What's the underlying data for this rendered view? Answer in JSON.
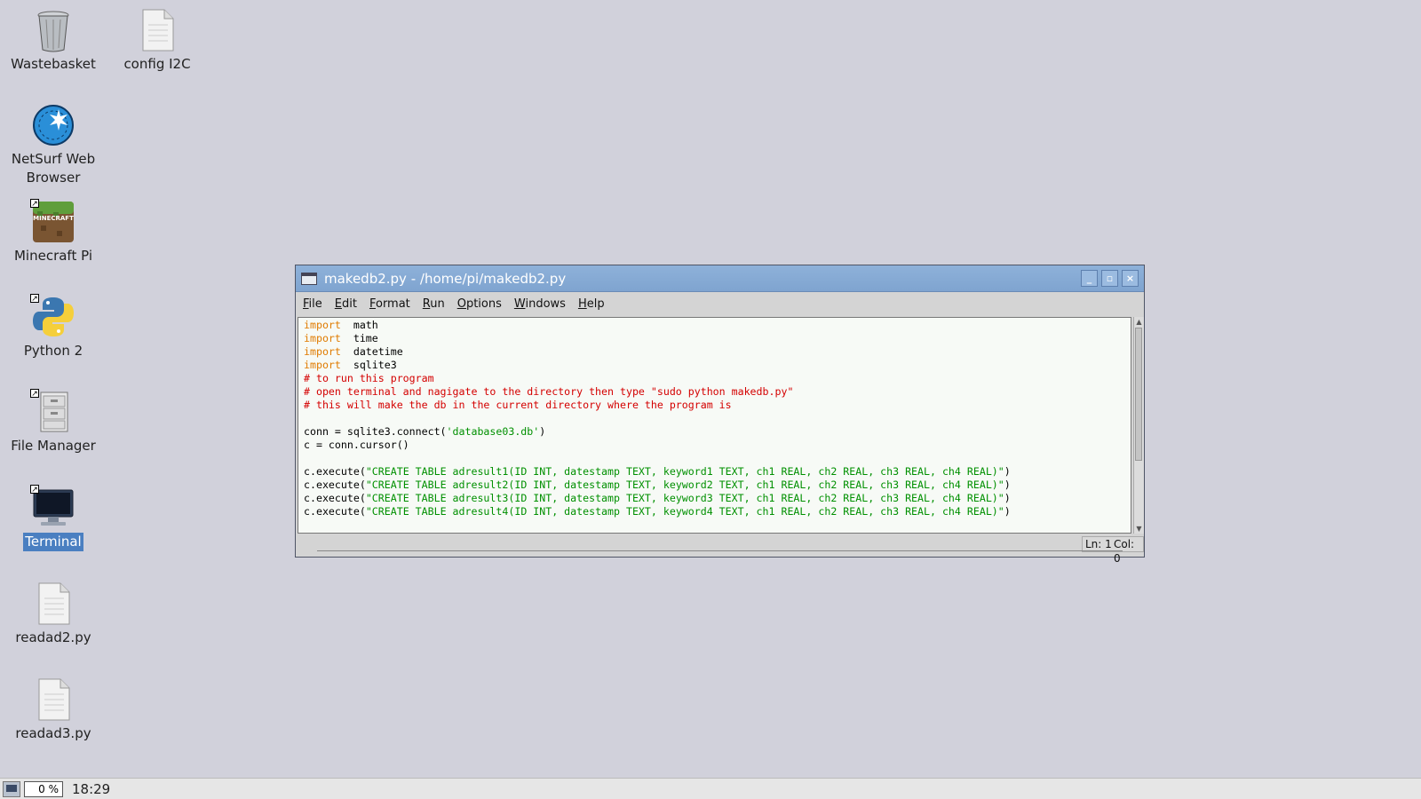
{
  "desktop": {
    "icons": [
      {
        "label": "Wastebasket",
        "icon": "trash-icon"
      },
      {
        "label": "config I2C",
        "icon": "file-icon"
      },
      {
        "label": "NetSurf Web Browser",
        "icon": "globe-icon"
      },
      {
        "label": "Minecraft Pi",
        "icon": "minecraft-icon"
      },
      {
        "label": "Python 2",
        "icon": "python-icon"
      },
      {
        "label": "File Manager",
        "icon": "cabinet-icon"
      },
      {
        "label": "Terminal",
        "icon": "monitor-icon"
      },
      {
        "label": "readad2.py",
        "icon": "file-icon"
      },
      {
        "label": "readad3.py",
        "icon": "file-icon"
      }
    ]
  },
  "window": {
    "title": "makedb2.py - /home/pi/makedb2.py",
    "menu": [
      {
        "label": "File",
        "underline": "F",
        "rest": "ile"
      },
      {
        "label": "Edit",
        "underline": "E",
        "rest": "dit"
      },
      {
        "label": "Format",
        "underline": "F",
        "rest": "ormat"
      },
      {
        "label": "Run",
        "underline": "R",
        "rest": "un"
      },
      {
        "label": "Options",
        "underline": "O",
        "rest": "ptions"
      },
      {
        "label": "Windows",
        "underline": "W",
        "rest": "indows"
      },
      {
        "label": "Help",
        "underline": "H",
        "rest": "elp"
      }
    ],
    "code_lines": [
      [
        [
          "kw",
          "import"
        ],
        [
          "",
          "  math"
        ]
      ],
      [
        [
          "kw",
          "import"
        ],
        [
          "",
          "  time"
        ]
      ],
      [
        [
          "kw",
          "import"
        ],
        [
          "",
          "  datetime"
        ]
      ],
      [
        [
          "kw",
          "import"
        ],
        [
          "",
          "  sqlite3"
        ]
      ],
      [
        [
          "cm",
          "# to run this program"
        ]
      ],
      [
        [
          "cm",
          "# open terminal and nagigate to the directory then type \"sudo python makedb.py\""
        ]
      ],
      [
        [
          "cm",
          "# this will make the db in the current directory where the program is"
        ]
      ],
      [
        [
          "",
          ""
        ]
      ],
      [
        [
          "",
          "conn = sqlite3.connect("
        ],
        [
          "st",
          "'database03.db'"
        ],
        [
          "",
          ")"
        ]
      ],
      [
        [
          "",
          "c = conn.cursor()"
        ]
      ],
      [
        [
          "",
          ""
        ]
      ],
      [
        [
          "",
          "c.execute("
        ],
        [
          "st",
          "\"CREATE TABLE adresult1(ID INT, datestamp TEXT, keyword1 TEXT, ch1 REAL, ch2 REAL, ch3 REAL, ch4 REAL)\""
        ],
        [
          "",
          ")"
        ]
      ],
      [
        [
          "",
          "c.execute("
        ],
        [
          "st",
          "\"CREATE TABLE adresult2(ID INT, datestamp TEXT, keyword2 TEXT, ch1 REAL, ch2 REAL, ch3 REAL, ch4 REAL)\""
        ],
        [
          "",
          ")"
        ]
      ],
      [
        [
          "",
          "c.execute("
        ],
        [
          "st",
          "\"CREATE TABLE adresult3(ID INT, datestamp TEXT, keyword3 TEXT, ch1 REAL, ch2 REAL, ch3 REAL, ch4 REAL)\""
        ],
        [
          "",
          ")"
        ]
      ],
      [
        [
          "",
          "c.execute("
        ],
        [
          "st",
          "\"CREATE TABLE adresult4(ID INT, datestamp TEXT, keyword4 TEXT, ch1 REAL, ch2 REAL, ch3 REAL, ch4 REAL)\""
        ],
        [
          "",
          ")"
        ]
      ]
    ],
    "status": {
      "line": "Ln: 1",
      "col": "Col: 0"
    }
  },
  "taskbar": {
    "cpu": "0 %",
    "clock": "18:29"
  }
}
